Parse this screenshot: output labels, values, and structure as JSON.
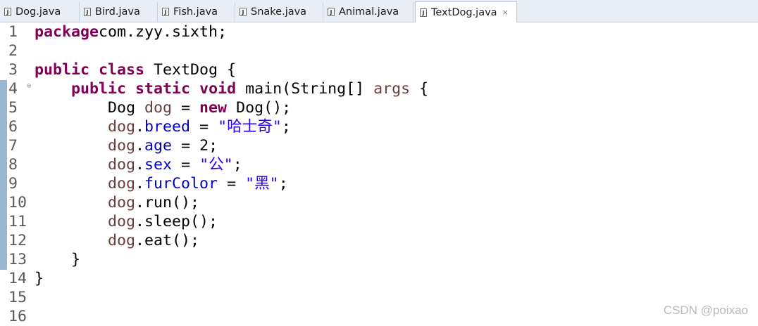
{
  "tabs": [
    {
      "label": "Dog.java",
      "active": false
    },
    {
      "label": "Bird.java",
      "active": false
    },
    {
      "label": "Fish.java",
      "active": false
    },
    {
      "label": "Snake.java",
      "active": false
    },
    {
      "label": "Animal.java",
      "active": false
    },
    {
      "label": "TextDog.java",
      "active": true,
      "close": "×"
    }
  ],
  "file_icon_glyph": "J",
  "fold_marker": "⊖",
  "lines": [
    {
      "n": "1",
      "segs": [
        [
          "kw",
          "package"
        ],
        [
          "",
          "com.zyy.sixth;"
        ]
      ]
    },
    {
      "n": "2",
      "segs": []
    },
    {
      "n": "3",
      "segs": [
        [
          "kw",
          "public"
        ],
        [
          "",
          " "
        ],
        [
          "kw",
          "class"
        ],
        [
          "",
          " TextDog {"
        ]
      ]
    },
    {
      "n": "4",
      "fold": true,
      "segs": [
        [
          "",
          "    "
        ],
        [
          "kw",
          "public"
        ],
        [
          "",
          " "
        ],
        [
          "kw",
          "static"
        ],
        [
          "",
          " "
        ],
        [
          "kw",
          "void"
        ],
        [
          "",
          " main(String[] "
        ],
        [
          "var",
          "args"
        ],
        [
          "",
          " {"
        ]
      ]
    },
    {
      "n": "5",
      "segs": [
        [
          "",
          "        Dog "
        ],
        [
          "var",
          "dog"
        ],
        [
          "",
          " = "
        ],
        [
          "kw",
          "new"
        ],
        [
          "",
          " Dog();"
        ]
      ]
    },
    {
      "n": "6",
      "segs": [
        [
          "",
          "        "
        ],
        [
          "var",
          "dog"
        ],
        [
          "",
          "."
        ],
        [
          "field",
          "breed"
        ],
        [
          "",
          " = "
        ],
        [
          "str",
          "\"哈士奇\""
        ],
        [
          "",
          ";"
        ]
      ]
    },
    {
      "n": "7",
      "segs": [
        [
          "",
          "        "
        ],
        [
          "var",
          "dog"
        ],
        [
          "",
          "."
        ],
        [
          "field",
          "age"
        ],
        [
          "",
          " = 2;"
        ]
      ]
    },
    {
      "n": "8",
      "segs": [
        [
          "",
          "        "
        ],
        [
          "var",
          "dog"
        ],
        [
          "",
          "."
        ],
        [
          "field",
          "sex"
        ],
        [
          "",
          " = "
        ],
        [
          "str",
          "\"公\""
        ],
        [
          "",
          ";"
        ]
      ]
    },
    {
      "n": "9",
      "segs": [
        [
          "",
          "        "
        ],
        [
          "var",
          "dog"
        ],
        [
          "",
          "."
        ],
        [
          "field",
          "furColor"
        ],
        [
          "",
          " = "
        ],
        [
          "str",
          "\"黑\""
        ],
        [
          "",
          ";"
        ]
      ]
    },
    {
      "n": "10",
      "segs": [
        [
          "",
          "        "
        ],
        [
          "var",
          "dog"
        ],
        [
          "",
          ".run();"
        ]
      ]
    },
    {
      "n": "11",
      "segs": [
        [
          "",
          "        "
        ],
        [
          "var",
          "dog"
        ],
        [
          "",
          ".sleep();"
        ]
      ]
    },
    {
      "n": "12",
      "segs": [
        [
          "",
          "        "
        ],
        [
          "var",
          "dog"
        ],
        [
          "",
          ".eat();"
        ]
      ]
    },
    {
      "n": "13",
      "segs": [
        [
          "",
          "    }"
        ]
      ]
    },
    {
      "n": "14",
      "segs": [
        [
          "",
          "}"
        ]
      ]
    },
    {
      "n": "15",
      "segs": []
    },
    {
      "n": "16",
      "segs": []
    }
  ],
  "watermark": "CSDN @poixao",
  "colors": {
    "keyword": "#7f0055",
    "field": "#0000c0",
    "local_variable": "#6a3e3e",
    "string": "#2a00ff"
  }
}
